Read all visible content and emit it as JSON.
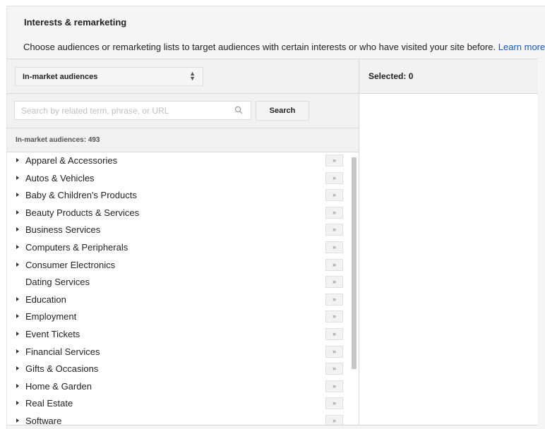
{
  "section": {
    "title": "Interests & remarketing",
    "description": "Choose audiences or remarketing lists to target audiences with certain interests or who have visited your site before.",
    "learn_more": "Learn more",
    "link_color": "#1a57b8"
  },
  "picker": {
    "type_select": {
      "value": "In-market audiences",
      "icon": "up-down-arrows-icon"
    },
    "search": {
      "placeholder": "Search by related term, phrase, or URL",
      "value": "",
      "icon": "search-icon",
      "button_label": "Search"
    },
    "count_label": "In-market audiences: 493",
    "add_button_glyph": "»",
    "items": [
      {
        "label": "Apparel & Accessories",
        "expandable": true
      },
      {
        "label": "Autos & Vehicles",
        "expandable": true
      },
      {
        "label": "Baby & Children's Products",
        "expandable": true
      },
      {
        "label": "Beauty Products & Services",
        "expandable": true
      },
      {
        "label": "Business Services",
        "expandable": true
      },
      {
        "label": "Computers & Peripherals",
        "expandable": true
      },
      {
        "label": "Consumer Electronics",
        "expandable": true
      },
      {
        "label": "Dating Services",
        "expandable": false
      },
      {
        "label": "Education",
        "expandable": true
      },
      {
        "label": "Employment",
        "expandable": true
      },
      {
        "label": "Event Tickets",
        "expandable": true
      },
      {
        "label": "Financial Services",
        "expandable": true
      },
      {
        "label": "Gifts & Occasions",
        "expandable": true
      },
      {
        "label": "Home & Garden",
        "expandable": true
      },
      {
        "label": "Real Estate",
        "expandable": true
      },
      {
        "label": "Software",
        "expandable": true
      }
    ]
  },
  "selected": {
    "label": "Selected: 0"
  }
}
